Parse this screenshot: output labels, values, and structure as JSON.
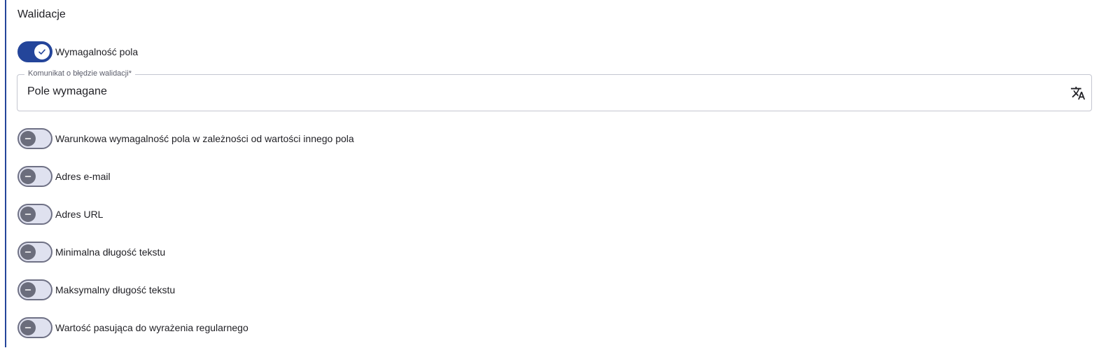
{
  "section": {
    "title": "Walidacje"
  },
  "required_toggle": {
    "label": "Wymagalność pola",
    "checked": true
  },
  "error_message_field": {
    "label": "Komunikat o błędzie walidacji*",
    "value": "Pole wymagane",
    "icon": "translate-icon"
  },
  "validation_toggles": [
    {
      "label": "Warunkowa wymagalność pola w zależności od wartości innego pola",
      "checked": false
    },
    {
      "label": "Adres e-mail",
      "checked": false
    },
    {
      "label": "Adres URL",
      "checked": false
    },
    {
      "label": "Minimalna długość tekstu",
      "checked": false
    },
    {
      "label": "Maksymalny długość tekstu",
      "checked": false
    },
    {
      "label": "Wartość pasująca do wyrażenia regularnego",
      "checked": false
    }
  ],
  "colors": {
    "accent": "#24459a",
    "switch_off_track": "#dfe1ef",
    "switch_off_knob": "#6b6d7c",
    "field_border": "#c4c6d0"
  }
}
